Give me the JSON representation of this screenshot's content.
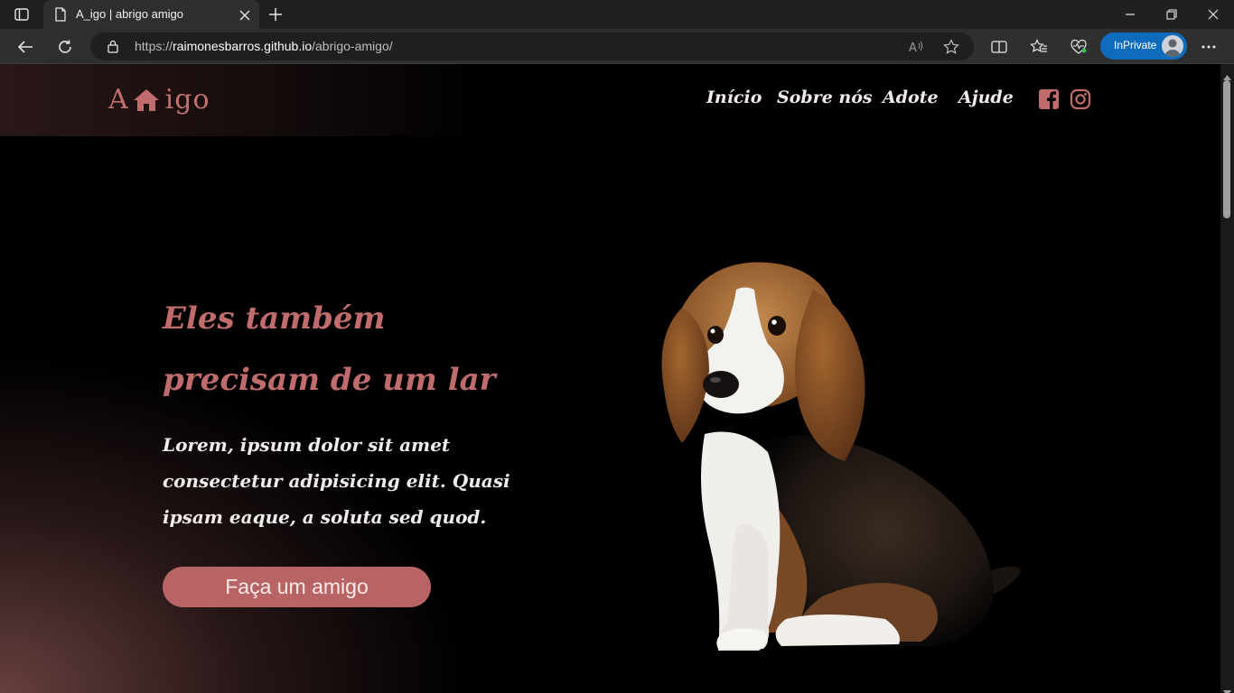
{
  "browser": {
    "tab_title": "A_igo | abrigo amigo",
    "url_prefix": "https://",
    "url_host": "raimonesbarros.github.io",
    "url_path": "/abrigo-amigo/",
    "inprivate_label": "InPrivate"
  },
  "site": {
    "logo_left": "A",
    "logo_right": "igo",
    "nav": {
      "inicio": "Início",
      "sobre": "Sobre nós",
      "adote": "Adote",
      "ajude": "Ajude"
    }
  },
  "hero": {
    "title_line1": "Eles também",
    "title_line2": "precisam de um lar",
    "text_line1": "Lorem, ipsum dolor sit amet",
    "text_line2": "consectetur adipisicing elit. Quasi",
    "text_line3": "ipsam eaque, a soluta sed quod.",
    "cta_label": "Faça um amigo"
  },
  "colors": {
    "accent": "#c06c6c",
    "button": "#b86464",
    "inprivate": "#0f6cbd"
  },
  "icons": [
    "tab-actions-icon",
    "page-icon",
    "close-icon",
    "plus-icon",
    "minimize-icon",
    "restore-icon",
    "back-icon",
    "refresh-icon",
    "lock-icon",
    "read-aloud-icon",
    "favorite-star-icon",
    "split-screen-icon",
    "favorites-icon",
    "browser-essentials-icon",
    "more-icon",
    "house-icon",
    "facebook-icon",
    "instagram-icon"
  ]
}
